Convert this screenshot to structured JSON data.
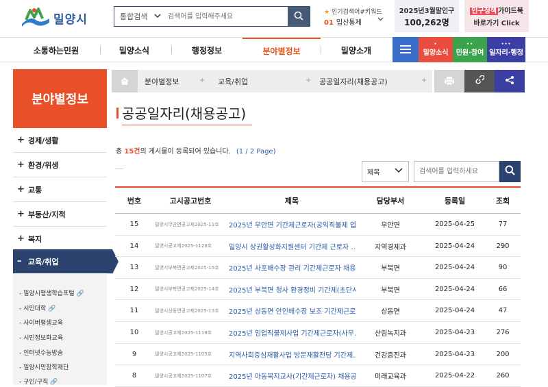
{
  "header": {
    "logo_text": "밀양시",
    "search_category": "통합검색",
    "search_placeholder": "검색어를 입력해주세요",
    "keyword_title": "인기검색어#키워드",
    "keyword_rank": "01",
    "keyword_text": "입산통제",
    "population_label": "2025년3월말인구",
    "population_value": "100,262명",
    "guide_line1_red": "인구정책",
    "guide_line1_rest": "가이드북",
    "guide_line2": "바로가기 Click"
  },
  "nav": {
    "items": [
      "소통하는민원",
      "밀양소식",
      "행정정보",
      "분야별정보",
      "밀양소개"
    ],
    "active_index": 3,
    "quick": [
      {
        "label": "밀양소식",
        "color": "#e84d3d"
      },
      {
        "label": "민원·참여",
        "color": "#3ca24b"
      },
      {
        "label": "일자리·행정",
        "color": "#3b3fa3"
      }
    ]
  },
  "sidebar": {
    "title": "분야별정보",
    "items": [
      "경제/생활",
      "환경/위생",
      "교통",
      "부동산/지적",
      "복지",
      "교육/취업"
    ],
    "active_index": 5,
    "sub_items": [
      {
        "label": "밀양시평생학습포털",
        "link": true
      },
      {
        "label": "시민대학",
        "link": true
      },
      {
        "label": "사이버평생교육",
        "link": false
      },
      {
        "label": "시민정보화교육",
        "link": false
      },
      {
        "label": "인터넷수능방송",
        "link": false
      },
      {
        "label": "밀양시민장학재단",
        "link": false
      },
      {
        "label": "구인/구직",
        "link": true
      }
    ]
  },
  "breadcrumb": [
    "분야별정보",
    "교육/취업",
    "공공일자리(채용공고)"
  ],
  "page": {
    "title": "공공일자리(채용공고)",
    "count_prefix": "총 ",
    "count_value": "15건",
    "count_suffix": "의 게시물이 등록되어 있습니다.",
    "page_info": "(1 / 2 Page)",
    "filter_selected": "제목",
    "filter_placeholder": "검색어를 입력하세요"
  },
  "table": {
    "headers": [
      "번호",
      "고시공고번호",
      "제목",
      "담당부서",
      "등록일",
      "조회"
    ],
    "rows": [
      {
        "no": "15",
        "code": "밀양시무안면공고제2025-11호",
        "title": "2025년 무안면 기간제근로자(공익직불제 업…",
        "dept": "무안면",
        "date": "2025-04-25",
        "views": "77"
      },
      {
        "no": "14",
        "code": "밀양시공고제2025-1128호",
        "title": "밀양시 상권활성화지원센터 기간제 근로자 …",
        "dept": "지역경제과",
        "date": "2025-04-24",
        "views": "290"
      },
      {
        "no": "13",
        "code": "밀양시부북면공고제2025-15호",
        "title": "2025년 사포배수장 관리 기간제근로자 채용 …",
        "dept": "부북면",
        "date": "2025-04-24",
        "views": "90"
      },
      {
        "no": "12",
        "code": "밀양시부북면공고제2025-14호",
        "title": "2025년 부북면 청사 환경정비 기간제(초단시…",
        "dept": "부북면",
        "date": "2025-04-24",
        "views": "66"
      },
      {
        "no": "11",
        "code": "밀양시상동면공고제2025-13호",
        "title": "2025년 상동면 안인배수장 보조 기간제근로…",
        "dept": "상동면",
        "date": "2025-04-24",
        "views": "47"
      },
      {
        "no": "10",
        "code": "밀양시공고제2025-1118호",
        "title": "2025년 임업직불제사업 기간제근로자(사무…",
        "dept": "산림녹지과",
        "date": "2025-04-23",
        "views": "276"
      },
      {
        "no": "9",
        "code": "밀양시공고제2025-1105호",
        "title": "지역사회중심재활사업 방문재활전담 기간제…",
        "dept": "건강증진과",
        "date": "2025-04-23",
        "views": "200"
      },
      {
        "no": "8",
        "code": "밀양시공고제2025-1107호",
        "title": "2025년 아동복지교사(기간제근로자) 채용공고",
        "dept": "미래교육과",
        "date": "2025-04-22",
        "views": "260"
      }
    ]
  }
}
